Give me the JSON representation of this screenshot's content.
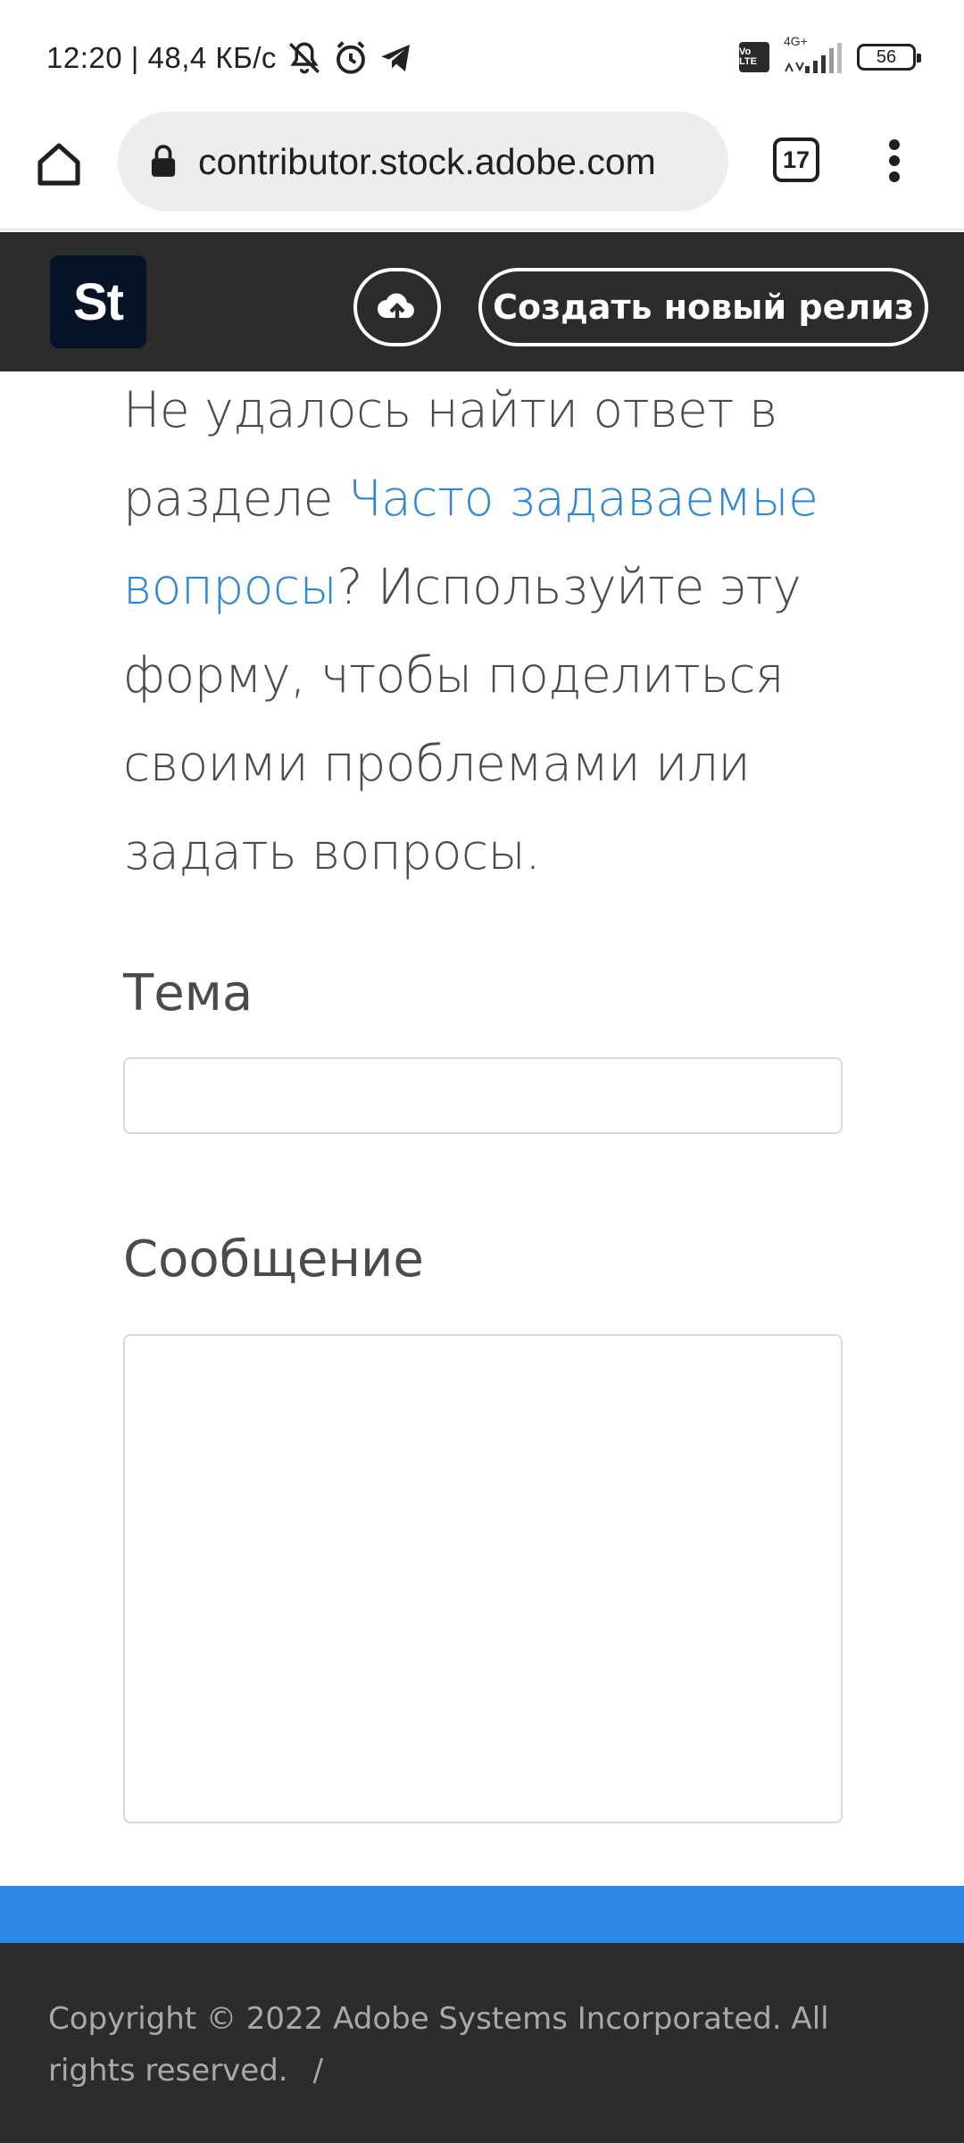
{
  "status_bar": {
    "time_speed": "12:20 | 48,4 КБ/с",
    "icons": [
      "mute-icon",
      "alarm-icon",
      "telegram-icon"
    ],
    "volte": "Vo LTE",
    "network": "4G+",
    "battery": "56"
  },
  "browser": {
    "url": "contributor.stock.adobe.com",
    "tab_count": "17"
  },
  "header": {
    "logo": "St",
    "create_button": "Создать новый релиз"
  },
  "content": {
    "intro_before": "Не удалось найти ответ в разделе ",
    "intro_link": "Часто задаваемые вопросы",
    "intro_after": "? Используйте эту форму, чтобы поделиться своими проблемами или задать вопросы.",
    "topic_label": "Тема",
    "topic_value": "",
    "message_label": "Сообщение",
    "message_value": ""
  },
  "footer": {
    "copyright": "Copyright © 2022 Adobe Systems Incorporated. All rights reserved.",
    "separator": "/"
  },
  "colors": {
    "header_bg": "#2c2c2c",
    "link": "#2d87d8",
    "blue_band": "#2f86e4",
    "logo_bg": "#061326"
  }
}
